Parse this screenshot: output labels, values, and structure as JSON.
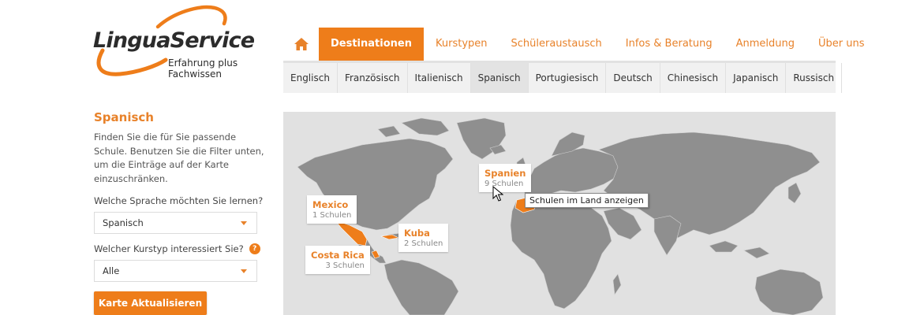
{
  "logo": {
    "name": "LinguaService",
    "tagline_line1": "Erfahrung plus",
    "tagline_line2": "Fachwissen"
  },
  "main_nav": {
    "home_icon": "home-icon",
    "items": [
      {
        "label": "Destinationen",
        "active": true
      },
      {
        "label": "Kurstypen"
      },
      {
        "label": "Schüleraustausch"
      },
      {
        "label": "Infos & Beratung"
      },
      {
        "label": "Anmeldung"
      },
      {
        "label": "Über uns"
      }
    ]
  },
  "sub_nav": {
    "items": [
      {
        "label": "Englisch"
      },
      {
        "label": "Französisch"
      },
      {
        "label": "Italienisch"
      },
      {
        "label": "Spanisch",
        "active": true
      },
      {
        "label": "Portugiesisch"
      },
      {
        "label": "Deutsch"
      },
      {
        "label": "Chinesisch"
      },
      {
        "label": "Japanisch"
      },
      {
        "label": "Russisch"
      }
    ]
  },
  "sidebar": {
    "title": "Spanisch",
    "intro": "Finden Sie die für Sie passende Schule. Benutzen Sie die Filter unten, um die Einträge auf der Karte einzuschränken.",
    "language_label": "Welche Sprache möchten Sie lernen?",
    "language_value": "Spanisch",
    "course_label": "Welcher Kurstyp interessiert Sie?",
    "help_glyph": "?",
    "course_value": "Alle",
    "button_label": "Karte Aktualisieren"
  },
  "map": {
    "pins": [
      {
        "name": "Spanien",
        "count": "9 Schulen"
      },
      {
        "name": "Mexico",
        "count": "1 Schulen"
      },
      {
        "name": "Kuba",
        "count": "2 Schulen"
      },
      {
        "name": "Costa Rica",
        "count": "3 Schulen"
      }
    ],
    "tooltip": "Schulen im Land anzeigen"
  },
  "colors": {
    "accent": "#ee7d1a",
    "map_land": "#8f8f8f",
    "map_sea": "#e1e1e1"
  }
}
